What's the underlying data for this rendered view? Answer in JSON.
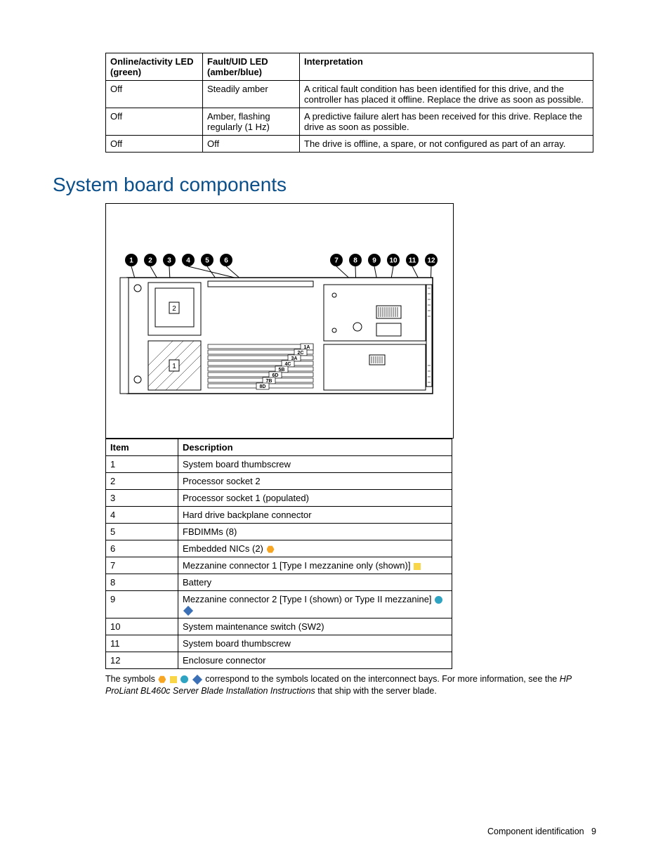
{
  "led_table": {
    "headers": [
      "Online/activity LED (green)",
      "Fault/UID LED (amber/blue)",
      "Interpretation"
    ],
    "rows": [
      {
        "c0": "Off",
        "c1": "Steadily amber",
        "c2": "A critical fault condition has been identified for this drive, and the controller has placed it offline. Replace the drive as soon as possible."
      },
      {
        "c0": "Off",
        "c1": "Amber, flashing regularly (1 Hz)",
        "c2": "A predictive failure alert has been received for this drive. Replace the drive as soon as possible."
      },
      {
        "c0": "Off",
        "c1": "Off",
        "c2": "The drive is offline, a spare, or not configured as part of an array."
      }
    ]
  },
  "heading": "System board components",
  "callouts": [
    "1",
    "2",
    "3",
    "4",
    "5",
    "6",
    "7",
    "8",
    "9",
    "10",
    "11",
    "12"
  ],
  "dimm_labels": [
    "1A",
    "2C",
    "3A",
    "4C",
    "5B",
    "6D",
    "7B",
    "8D"
  ],
  "cpu_labels": {
    "sock2": "2",
    "sock1": "1"
  },
  "comp_table": {
    "headers": [
      "Item",
      "Description"
    ],
    "rows": [
      {
        "item": "1",
        "desc": "System board thumbscrew"
      },
      {
        "item": "2",
        "desc": "Processor socket 2"
      },
      {
        "item": "3",
        "desc": "Processor socket 1 (populated)"
      },
      {
        "item": "4",
        "desc": "Hard drive backplane connector"
      },
      {
        "item": "5",
        "desc": "FBDIMMs (8)"
      },
      {
        "item": "6",
        "desc": "Embedded NICs (2)"
      },
      {
        "item": "7",
        "desc": "Mezzanine connector 1 [Type I mezzanine only (shown)]"
      },
      {
        "item": "8",
        "desc": "Battery"
      },
      {
        "item": "9",
        "desc": "Mezzanine connector 2 [Type I (shown) or Type II mezzanine]"
      },
      {
        "item": "10",
        "desc": "System maintenance switch (SW2)"
      },
      {
        "item": "11",
        "desc": "System board thumbscrew"
      },
      {
        "item": "12",
        "desc": "Enclosure connector"
      }
    ]
  },
  "footnote": {
    "pre": "The symbols ",
    "post": " correspond to the symbols located on the interconnect bays. For more information, see the ",
    "doc_title": "HP ProLiant BL460c Server Blade Installation Instructions",
    "tail": " that ship with the server blade."
  },
  "footer": {
    "section": "Component identification",
    "page": "9"
  }
}
